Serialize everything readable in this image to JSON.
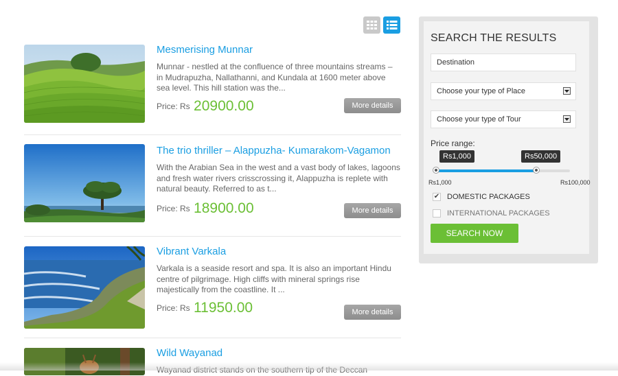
{
  "view_toggle": {
    "grid_icon": "grid-view-icon",
    "list_icon": "list-view-icon",
    "active": "list"
  },
  "listings": [
    {
      "title": "Mesmerising Munnar",
      "description": "Munnar - nestled at the confluence of three mountains streams – in Mudrapuzha, Nallathanni, and Kundala at 1600 meter above sea level. This hill station was the...",
      "price_label": "Price: Rs",
      "price": "20900.00",
      "button": "More details"
    },
    {
      "title": "The trio thriller – Alappuzha- Kumarakom-Vagamon",
      "description": "With the Arabian Sea in the west and a vast body of lakes, lagoons and fresh water rivers crisscrossing it, Alappuzha is replete with natural beauty. Referred to as t...",
      "price_label": "Price: Rs",
      "price": "18900.00",
      "button": "More details"
    },
    {
      "title": "Vibrant Varkala",
      "description": "Varkala is a seaside resort and spa. It is also an important Hindu centre of pilgrimage. High cliffs with mineral springs rise majestically from the coastline. It ...",
      "price_label": "Price: Rs",
      "price": "11950.00",
      "button": "More details"
    },
    {
      "title": "Wild Wayanad",
      "description": "Wayanad district stands on the southern tip of the Deccan"
    }
  ],
  "search": {
    "title": "SEARCH THE RESULTS",
    "destination_placeholder": "Destination",
    "place_select": "Choose your type of Place",
    "tour_select": "Choose your type of Tour",
    "price_range_label": "Price range:",
    "tip_low": "Rs1,000",
    "tip_high": "Rs50,000",
    "min_label": "Rs1,000",
    "max_label": "Rs100,000",
    "range_min": 1000,
    "range_max": 100000,
    "value_low": 1000,
    "value_high": 50000,
    "domestic_label": "DOMESTIC PACKAGES",
    "domestic_checked": true,
    "international_label": "INTERNATIONAL PACKAGES",
    "international_checked": false,
    "button": "SEARCH NOW"
  },
  "colors": {
    "accent": "#1a9ee2",
    "price_green": "#6bbf35",
    "button_grey": "#999999"
  }
}
